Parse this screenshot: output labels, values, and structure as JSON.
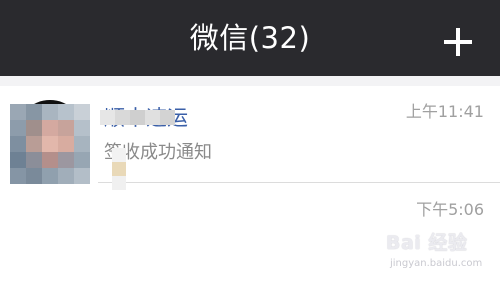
{
  "header": {
    "title": "微信(32)",
    "add_icon": "plus-icon"
  },
  "chats": [
    {
      "name": "顺丰速运",
      "preview": "签收成功通知",
      "time": "上午11:41",
      "avatar_icon": "sf-express-logo"
    },
    {
      "name": "",
      "preview": "",
      "time": "下午5:06",
      "avatar_icon": "pixelated-avatar"
    }
  ],
  "watermark": {
    "text": "Bai 经验",
    "sub": "jingyan.baidu.com"
  },
  "colors": {
    "nav_bg": "#2a2a2e",
    "name_blue": "#3a5fa8",
    "gray_text": "#8a8a8a",
    "sf_black": "#111111"
  }
}
